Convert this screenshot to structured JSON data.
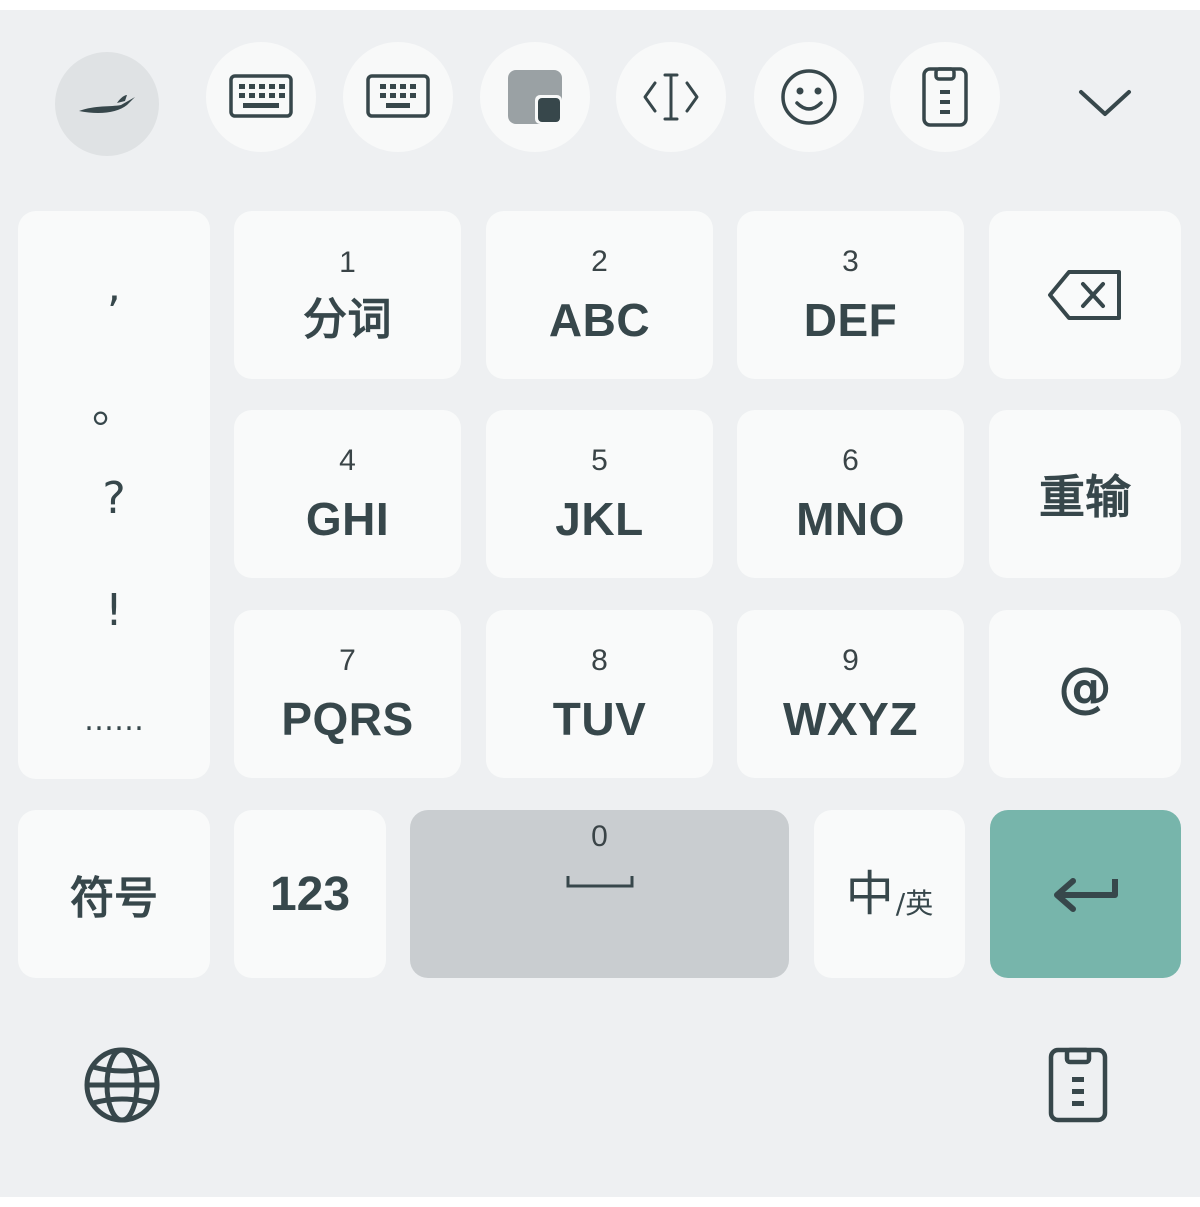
{
  "toolbar": {
    "items": [
      {
        "name": "logo",
        "icon": "swift-logo-icon"
      },
      {
        "name": "keyboard-layout",
        "icon": "keyboard-icon"
      },
      {
        "name": "keyboard-compact",
        "icon": "keyboard-small-icon"
      },
      {
        "name": "floating-window",
        "icon": "window-icon"
      },
      {
        "name": "cursor-edit",
        "icon": "text-cursor-icon"
      },
      {
        "name": "emoji",
        "icon": "smiley-icon"
      },
      {
        "name": "clipboard",
        "icon": "clipboard-icon"
      },
      {
        "name": "collapse",
        "icon": "chevron-down-icon"
      }
    ]
  },
  "punctuation": [
    ",",
    "。",
    "?",
    "!",
    "……"
  ],
  "keys": {
    "k1": {
      "num": "1",
      "label": "分词"
    },
    "k2": {
      "num": "2",
      "label": "ABC"
    },
    "k3": {
      "num": "3",
      "label": "DEF"
    },
    "k4": {
      "num": "4",
      "label": "GHI"
    },
    "k5": {
      "num": "5",
      "label": "JKL"
    },
    "k6": {
      "num": "6",
      "label": "MNO"
    },
    "k7": {
      "num": "7",
      "label": "PQRS"
    },
    "k8": {
      "num": "8",
      "label": "TUV"
    },
    "k9": {
      "num": "9",
      "label": "WXYZ"
    },
    "k0": {
      "num": "0"
    }
  },
  "side": {
    "reinput": "重输",
    "at": "@"
  },
  "bottom_row": {
    "symbols": "符号",
    "numbers": "123",
    "lang_main": "中",
    "lang_sub": "/英"
  },
  "colors": {
    "background": "#eef0f2",
    "key": "#f9fafa",
    "space": "#c9cdd0",
    "enter": "#77b5ab",
    "text": "#37474b"
  }
}
